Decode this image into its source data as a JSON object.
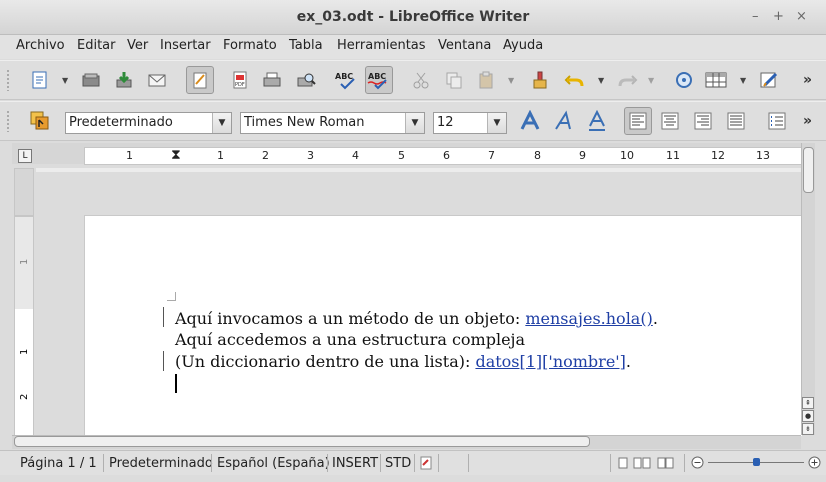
{
  "window": {
    "title": "ex_03.odt - LibreOffice Writer",
    "minimize": "–",
    "maximize": "+",
    "close": "×"
  },
  "menu": {
    "items": [
      "Archivo",
      "Editar",
      "Ver",
      "Insertar",
      "Formato",
      "Tabla",
      "Herramientas",
      "Ventana",
      "Ayuda"
    ]
  },
  "toolbar1": {
    "icons": [
      "new-document-icon",
      "open-icon",
      "save-icon",
      "email-icon",
      "edit-mode-icon",
      "export-pdf-icon",
      "print-icon",
      "print-preview-icon",
      "spellcheck-icon",
      "autospellcheck-icon",
      "cut-icon",
      "copy-icon",
      "paste-icon",
      "clone-formatting-icon",
      "undo-icon",
      "redo-icon",
      "navigator-icon",
      "table-icon",
      "draw-functions-icon"
    ],
    "spell_label": "ABC",
    "more": "»"
  },
  "toolbar2": {
    "style": "Predeterminado",
    "font": "Times New Roman",
    "size": "12",
    "more": "»"
  },
  "ruler": {
    "numbers": [
      "1",
      "1",
      "2",
      "3",
      "4",
      "5",
      "6",
      "7",
      "8",
      "9",
      "10",
      "11",
      "12",
      "13"
    ],
    "corner": "L"
  },
  "document": {
    "line1_text": "Aquí invocamos a un método de un objeto: ",
    "line1_link": "mensajes.hola()",
    "line1_end": ".",
    "line2_text": "Aquí accedemos a una estructura compleja",
    "line3_text": "(Un diccionario dentro de una lista): ",
    "line3_link": "datos[1]['nombre']",
    "line3_end": "."
  },
  "status": {
    "page": "Página  1 / 1",
    "style": "Predeterminado",
    "language": "Español (España)",
    "insert": "INSERT",
    "selection": "STD"
  },
  "colors": {
    "link": "#1f3fa5",
    "accent": "#3a6fb5"
  }
}
